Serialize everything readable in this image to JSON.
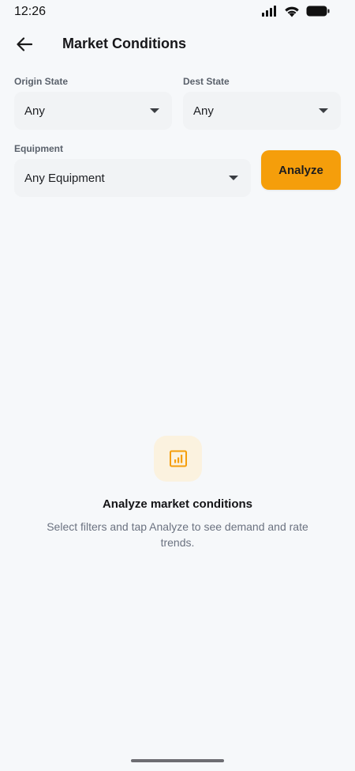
{
  "status": {
    "time": "12:26",
    "icons": [
      "signal-icon",
      "wifi-icon",
      "battery-icon"
    ]
  },
  "header": {
    "back_icon": "arrow-left-icon",
    "title": "Market Conditions"
  },
  "filters": {
    "origin": {
      "label": "Origin State",
      "value": "Any"
    },
    "dest": {
      "label": "Dest State",
      "value": "Any"
    },
    "equipment": {
      "label": "Equipment",
      "value": "Any Equipment"
    },
    "analyze_label": "Analyze"
  },
  "empty_state": {
    "icon": "bar-chart-icon",
    "title": "Analyze market conditions",
    "description": "Select filters and tap Analyze to see demand and rate trends."
  },
  "colors": {
    "accent": "#f59e0b",
    "background": "#f6f8fa",
    "field_background": "#f1f3f5",
    "icon_tint_background": "#fbf2df"
  }
}
